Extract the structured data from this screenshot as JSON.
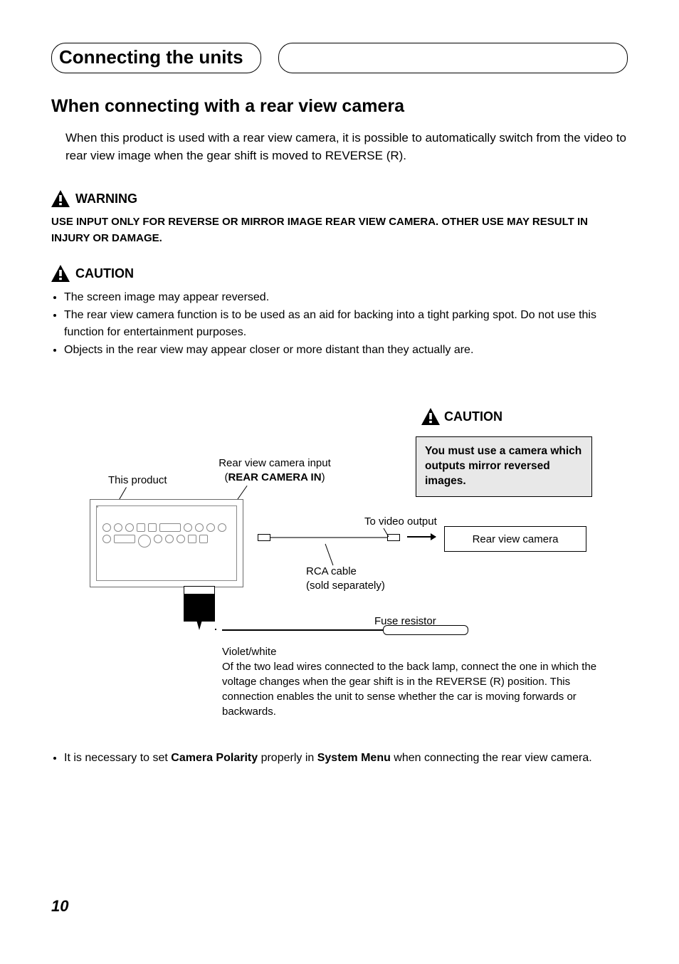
{
  "header": {
    "tab_title": "Connecting the units"
  },
  "section": {
    "heading": "When connecting with a rear view camera",
    "intro": "When this product is used with a rear view camera, it is possible to automatically switch from the video to rear view image when the gear shift is moved to REVERSE (R)."
  },
  "warning": {
    "label": "WARNING",
    "text": "USE INPUT ONLY FOR REVERSE OR MIRROR IMAGE REAR VIEW CAMERA. OTHER USE MAY RESULT IN INJURY OR DAMAGE."
  },
  "caution": {
    "label": "CAUTION",
    "items": [
      "The screen image may appear reversed.",
      "The rear view camera function is to be used as an aid for backing into a tight parking spot. Do not use this function for entertainment purposes.",
      "Objects in the rear view may appear closer or more distant than they actually are."
    ]
  },
  "diagram": {
    "caution_label": "CAUTION",
    "caution_box": "You must use a camera which outputs mirror reversed images.",
    "this_product": "This product",
    "rear_input_line1": "Rear view camera input",
    "rear_input_line2_open": "(",
    "rear_input_line2_bold": "REAR CAMERA IN",
    "rear_input_line2_close": ")",
    "to_video_output": "To video output",
    "rca_label": "RCA cable",
    "rca_note": "(sold separately)",
    "rear_view_camera": "Rear view camera",
    "fuse_resistor": "Fuse resistor",
    "violet_white": "Violet/white",
    "violet_note": "Of the two lead wires connected to the back lamp, connect the one in which the voltage changes when the gear shift is in the REVERSE (R) position. This connection enables the unit to sense whether the car is moving forwards or backwards."
  },
  "bottom_note": {
    "prefix": "It is necessary to set ",
    "bold1": "Camera Polarity",
    "mid": " properly in ",
    "bold2": "System Menu",
    "suffix": " when connecting the rear view camera."
  },
  "page_number": "10"
}
